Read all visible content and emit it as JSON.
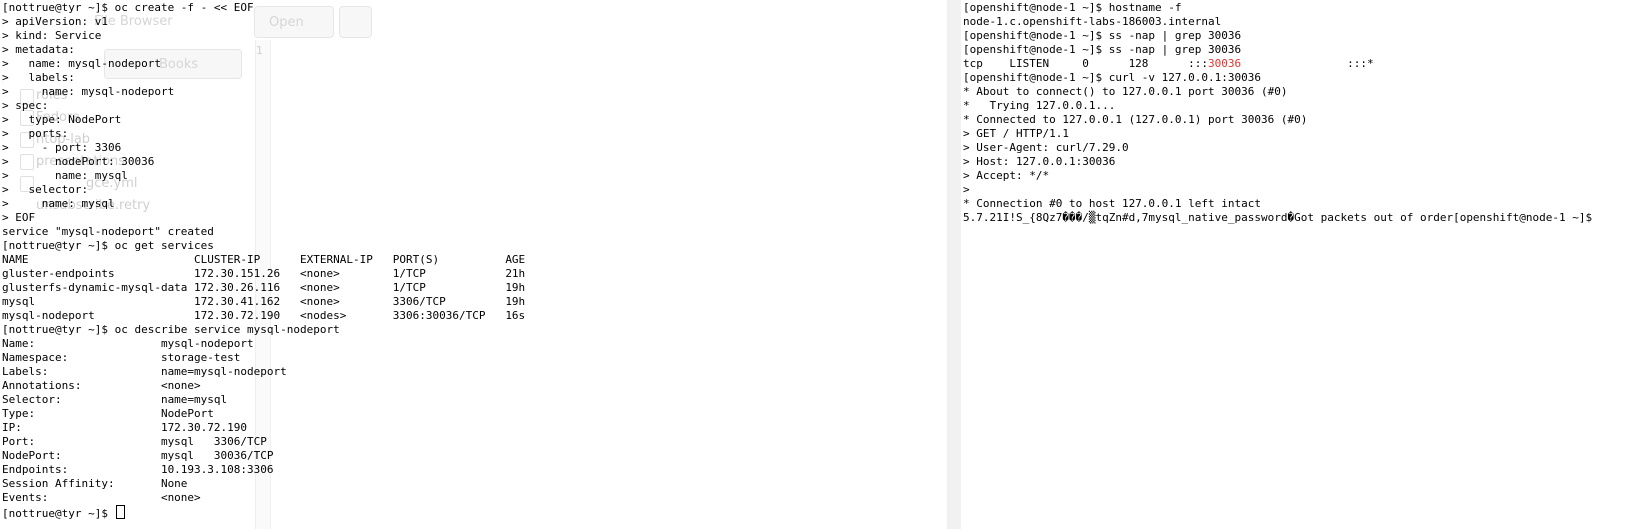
{
  "ghost_editor": {
    "browser_label": "File Browser",
    "open_label": "Open",
    "books_label": "Books",
    "line_number": "1",
    "files": [
      "roles",
      "Fedora",
      "htop-lab",
      "presentations",
      "gce.yml",
      "unsubscribe.retry"
    ]
  },
  "left_terminal": {
    "lines": [
      "[nottrue@tyr ~]$ oc create -f - << EOF",
      "> apiVersion: v1",
      "> kind: Service",
      "> metadata:",
      ">   name: mysql-nodeport",
      ">   labels:",
      ">     name: mysql-nodeport",
      "> spec:",
      ">   type: NodePort",
      ">   ports:",
      ">     - port: 3306",
      ">       nodePort: 30036",
      ">       name: mysql",
      ">   selector:",
      ">     name: mysql",
      "> EOF",
      "service \"mysql-nodeport\" created",
      "[nottrue@tyr ~]$ oc get services",
      "NAME                         CLUSTER-IP      EXTERNAL-IP   PORT(S)          AGE",
      "gluster-endpoints            172.30.151.26   <none>        1/TCP            21h",
      "glusterfs-dynamic-mysql-data 172.30.26.116   <none>        1/TCP            19h",
      "mysql                        172.30.41.162   <none>        3306/TCP         19h",
      "mysql-nodeport               172.30.72.190   <nodes>       3306:30036/TCP   16s",
      "[nottrue@tyr ~]$ oc describe service mysql-nodeport",
      "Name:                   mysql-nodeport",
      "Namespace:              storage-test",
      "Labels:                 name=mysql-nodeport",
      "Annotations:            <none>",
      "Selector:               name=mysql",
      "Type:                   NodePort",
      "IP:                     172.30.72.190",
      "Port:                   mysql   3306/TCP",
      "NodePort:               mysql   30036/TCP",
      "Endpoints:              10.193.3.108:3306",
      "Session Affinity:       None",
      "Events:                 <none>"
    ],
    "prompt": "[nottrue@tyr ~]$ "
  },
  "right_terminal": {
    "lines_before": [
      "[openshift@node-1 ~]$ hostname -f",
      "node-1.c.openshift-labs-186003.internal",
      "[openshift@node-1 ~]$ ss -nap | grep 30036",
      "[openshift@node-1 ~]$ ss -nap | grep 30036"
    ],
    "ss_line": {
      "prefix": "tcp    LISTEN     0      128      :::",
      "highlight": "30036",
      "suffix": "                :::*"
    },
    "lines_after": [
      "[openshift@node-1 ~]$ curl -v 127.0.0.1:30036",
      "* About to connect() to 127.0.0.1 port 30036 (#0)",
      "*   Trying 127.0.0.1...",
      "* Connected to 127.0.0.1 (127.0.0.1) port 30036 (#0)",
      "> GET / HTTP/1.1",
      "> User-Agent: curl/7.29.0",
      "> Host: 127.0.0.1:30036",
      "> Accept: */*",
      ">",
      "* Connection #0 to host 127.0.0.1 left intact",
      "5.7.21I!S_{8Qz7���/▒tqZn#d,7mysql_native_password�Got packets out of order[openshift@node-1 ~]$"
    ]
  },
  "colors": {
    "highlight": "#e5332e",
    "divider": "#f1f1f1"
  }
}
